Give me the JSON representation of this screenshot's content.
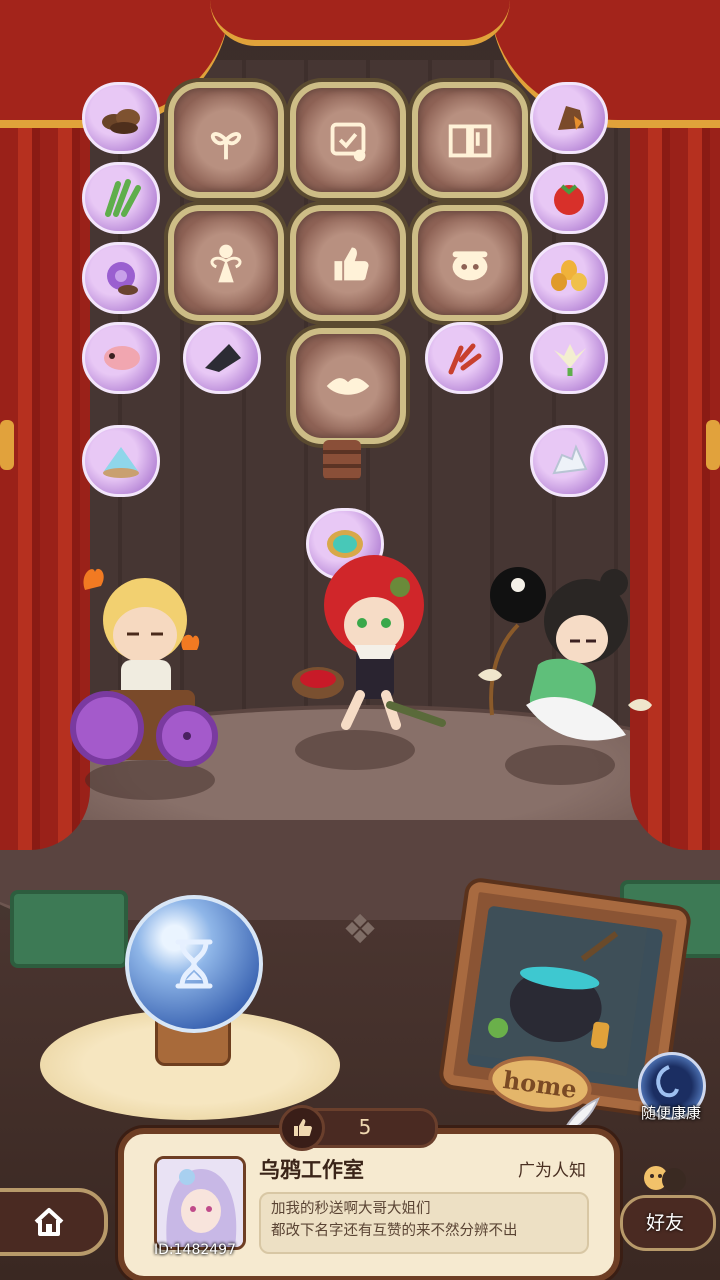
{
  "colors": {
    "curtain": "#b32a1f",
    "gold": "#e0a23a",
    "node_border": "#cdbd86",
    "bubble": "#d9b0ee",
    "panel": "#f6ead0"
  },
  "skill_tree": {
    "nodes": [
      {
        "id": "sprout",
        "icon": "sprout-icon"
      },
      {
        "id": "scroll",
        "icon": "scroll-icon"
      },
      {
        "id": "book",
        "icon": "book-icon"
      },
      {
        "id": "fairy",
        "icon": "fairy-icon"
      },
      {
        "id": "thumb",
        "icon": "thumbs-up-icon"
      },
      {
        "id": "pot",
        "icon": "cauldron-icon"
      },
      {
        "id": "lips",
        "icon": "lips-icon"
      }
    ]
  },
  "ingredients": {
    "left": [
      "mushroom-cluster-icon",
      "green-herb-icon",
      "purple-coral-icon",
      "larva-icon",
      "crystal-egg-icon"
    ],
    "inner_left": [
      "black-shard-icon"
    ],
    "inner_right": [
      "red-coral-icon"
    ],
    "right": [
      "amber-stone-icon",
      "tomato-icon",
      "yellow-flower-icon",
      "green-lily-icon",
      "white-crystal-icon"
    ],
    "center": [
      "green-gem-icon"
    ]
  },
  "characters": [
    "fire-boy-wheelchair",
    "red-hair-girl",
    "taiji-fisher-girl"
  ],
  "orb": {
    "icon": "hourglass-icon"
  },
  "home_frame": {
    "label": "home"
  },
  "shortcut": {
    "label": "随便康康",
    "icon": "portal-icon"
  },
  "profile": {
    "likes": "5",
    "studio_name": "乌鸦工作室",
    "fame": "广为人知",
    "bio_line1": "加我的秒送啊大哥大姐们",
    "bio_line2": "都改下名字还有互赞的来不然分辨不出",
    "user_id": "ID:1482497"
  },
  "nav": {
    "home_icon": "house-icon",
    "friends_label": "好友"
  }
}
